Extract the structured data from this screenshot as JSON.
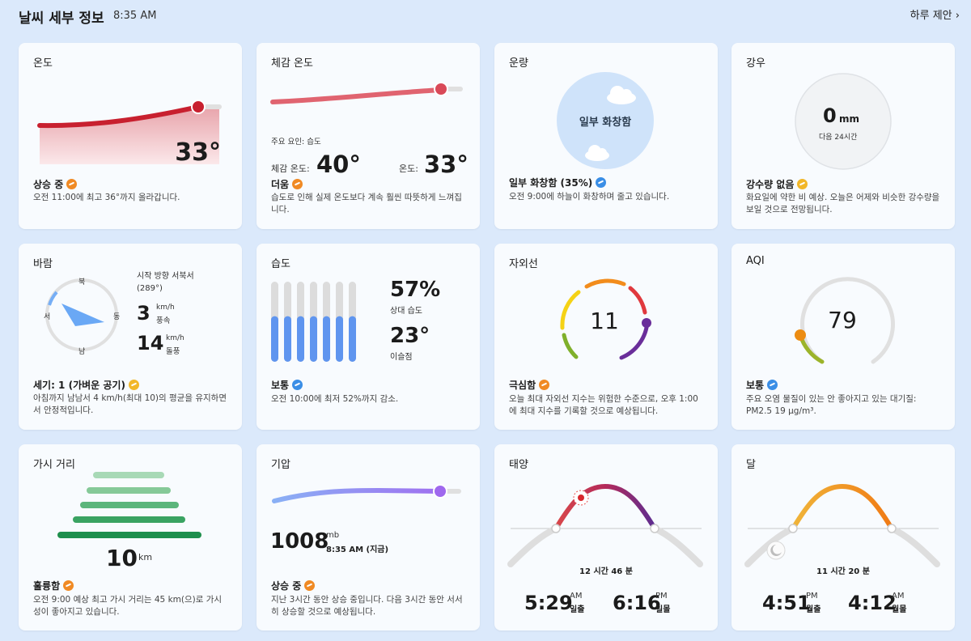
{
  "header": {
    "title": "날씨 세부 정보",
    "time": "8:35 AM",
    "link": "하루 제안"
  },
  "temperature": {
    "title": "온도",
    "value": "33°",
    "status": "상승 중",
    "desc": "오전 11:00에 최고 36°까지 올라갑니다."
  },
  "feels_like": {
    "title": "체감 온도",
    "factor": "주요 요인: 습도",
    "feels_label": "체감 온도:",
    "feels_value": "40°",
    "temp_label": "온도:",
    "temp_value": "33°",
    "status": "더움",
    "desc": "습도로 인해 실제 온도보다 계속 훨씬 따뜻하게 느껴집니다."
  },
  "cloud": {
    "title": "운량",
    "circle_text": "일부 화창함",
    "status": "일부 화창함 (35%)",
    "desc": "오전 9:00에 하늘이 화창하며 줄고 있습니다."
  },
  "rain": {
    "title": "강우",
    "value": "0",
    "unit": "mm",
    "sub": "다음 24시간",
    "status": "강수량 없음",
    "desc": "화요일에 약한 비 예상. 오늘은 어제와 비슷한 강수량을 보일 것으로 전망됩니다."
  },
  "wind": {
    "title": "바람",
    "n": "북",
    "e": "동",
    "s": "남",
    "w": "서",
    "direction": "시작 방향 서북서 (289°)",
    "speed": "3",
    "speed_unit": "km/h",
    "speed_label": "풍속",
    "gust": "14",
    "gust_unit": "km/h",
    "gust_label": "돌풍",
    "status": "세기: 1 (가벼운 공기)",
    "desc": "아침까지 남남서 4 km/h(최대 10)의 평균을 유지하면서 안정적입니다."
  },
  "humidity": {
    "title": "습도",
    "value": "57%",
    "value_label": "상대 습도",
    "dew": "23°",
    "dew_label": "이슬점",
    "status": "보통",
    "desc": "오전 10:00에 최저 52%까지 감소.",
    "bar_levels": [
      0.57,
      0.57,
      0.57,
      0.57,
      0.57,
      0.57,
      0.57
    ]
  },
  "uv": {
    "title": "자외선",
    "value": "11",
    "status": "극심함",
    "desc": "오늘 최대 자외선 지수는 위험한 수준으로, 오후 1:00에 최대 지수를 기록할 것으로 예상됩니다."
  },
  "aqi": {
    "title": "AQI",
    "value": "79",
    "status": "보통",
    "desc": "주요 오염 물질이 있는 안 좋아지고 있는 대기질: PM2.5 19 µg/m³."
  },
  "visibility": {
    "title": "가시 거리",
    "value": "10",
    "unit": "km",
    "status": "훌륭함",
    "desc": "오전 9:00 예상 최고 가시 거리는 45 km(으)로 가시성이 좋아지고 있습니다."
  },
  "pressure": {
    "title": "기압",
    "value": "1008",
    "unit": "mb",
    "time": "8:35 AM (지금)",
    "status": "상승 중",
    "desc": "지난 3시간 동안 상승 중입니다. 다음 3시간 동안 서서히 상승할 것으로 예상됩니다."
  },
  "sun": {
    "title": "태양",
    "duration": "12 시간 46 분",
    "rise_time": "5:29",
    "rise_ampm": "AM",
    "rise_label": "일출",
    "set_time": "6:16",
    "set_ampm": "PM",
    "set_label": "일몰"
  },
  "moon": {
    "title": "달",
    "duration": "11 시간 20 분",
    "rise_time": "4:51",
    "rise_ampm": "PM",
    "rise_label": "월출",
    "set_time": "4:12",
    "set_ampm": "AM",
    "set_label": "월몰"
  }
}
